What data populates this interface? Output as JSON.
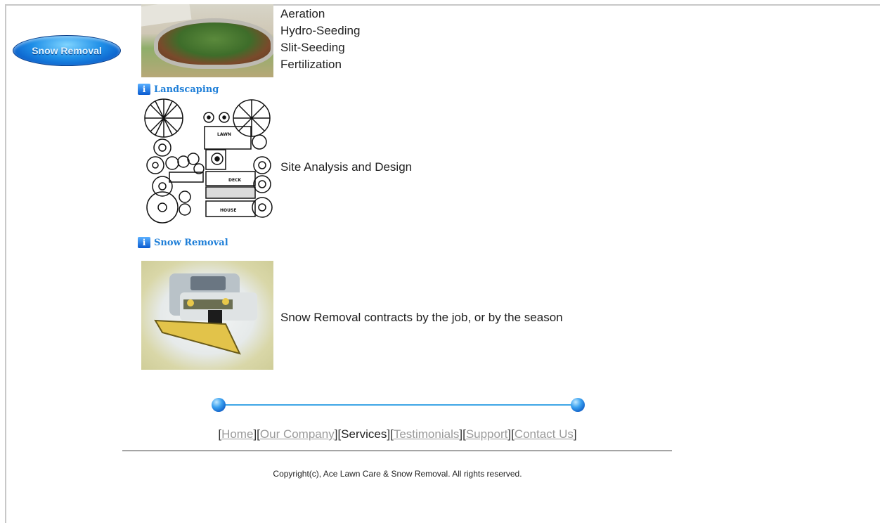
{
  "sidebar": {
    "button_label": "Snow Removal"
  },
  "services": {
    "lawn_items": [
      "Aeration",
      "Hydro-Seeding",
      "Slit-Seeding",
      "Fertilization"
    ],
    "landscaping": {
      "heading": "Landscaping",
      "description": "Site Analysis and Design",
      "plan_labels": [
        "LAWN",
        "DECK",
        "HOUSE"
      ]
    },
    "snow_removal": {
      "heading": "Snow Removal",
      "description": "Snow Removal contracts by the job, or by the season"
    }
  },
  "footer_nav": {
    "home": "Home",
    "our_company": "Our Company",
    "services": "Services",
    "testimonials": "Testimonials",
    "support": "Support",
    "contact_us": "Contact Us"
  },
  "copyright": "Copyright(c), Ace Lawn Care & Snow Removal. All rights reserved.",
  "colors": {
    "accent_blue": "#1f7fd8",
    "link_gray": "#9a9a9a",
    "divider_blue": "#3fa6e6"
  }
}
